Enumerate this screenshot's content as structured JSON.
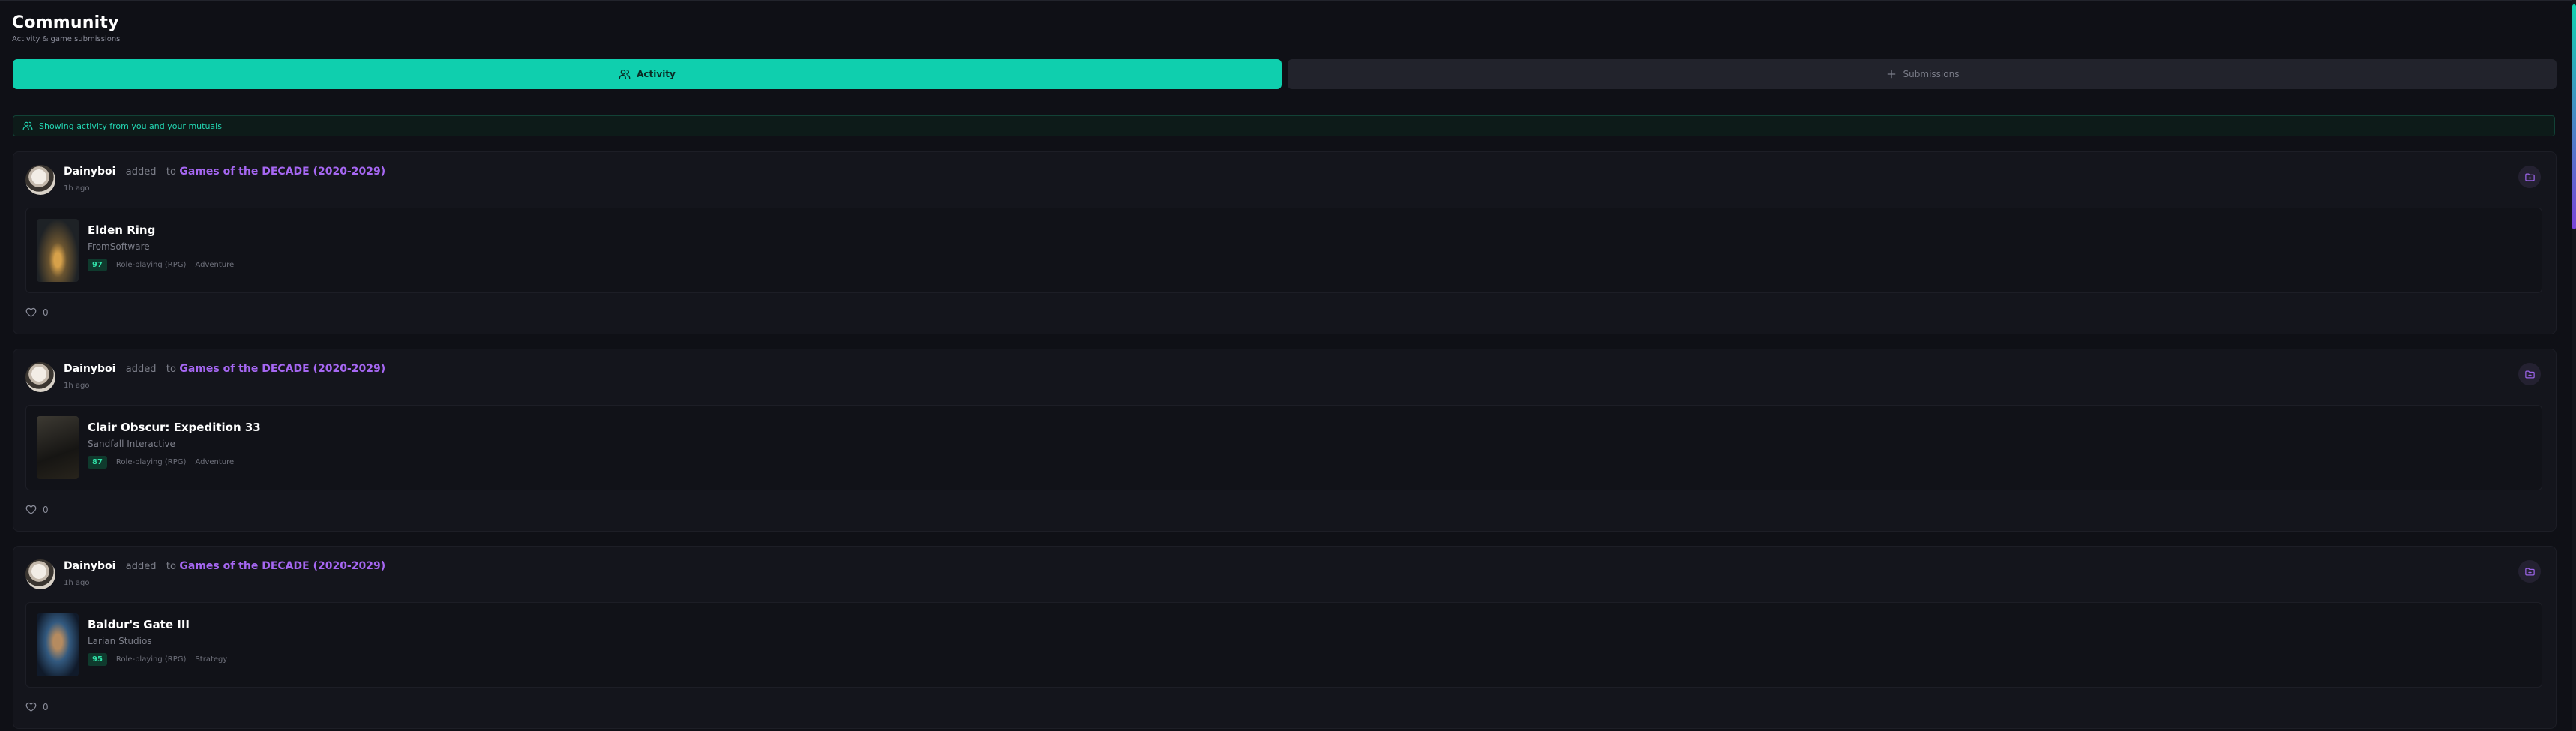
{
  "page": {
    "title": "Community",
    "subtitle": "Activity & game submissions"
  },
  "tabs": [
    {
      "label": "Activity",
      "active": true,
      "icon": "users-icon"
    },
    {
      "label": "Submissions",
      "active": false,
      "icon": "plus-icon"
    }
  ],
  "notice": {
    "text": "Showing activity from you and your mutuals",
    "icon": "users-icon"
  },
  "colors": {
    "accent": "#0fcfae",
    "list_link": "#a667f2",
    "score_bg": "#0f3a2d"
  },
  "feed": [
    {
      "user": "Dainyboi",
      "action": "added",
      "preposition": "to",
      "list": "Games of the DECADE (2020-2029)",
      "time": "1h ago",
      "game": {
        "title": "Elden Ring",
        "developer": "FromSoftware",
        "score": "97",
        "genres": [
          "Role-playing (RPG)",
          "Adventure"
        ]
      },
      "likes": "0"
    },
    {
      "user": "Dainyboi",
      "action": "added",
      "preposition": "to",
      "list": "Games of the DECADE (2020-2029)",
      "time": "1h ago",
      "game": {
        "title": "Clair Obscur: Expedition 33",
        "developer": "Sandfall Interactive",
        "score": "87",
        "genres": [
          "Role-playing (RPG)",
          "Adventure"
        ]
      },
      "likes": "0"
    },
    {
      "user": "Dainyboi",
      "action": "added",
      "preposition": "to",
      "list": "Games of the DECADE (2020-2029)",
      "time": "1h ago",
      "game": {
        "title": "Baldur's Gate III",
        "developer": "Larian Studios",
        "score": "95",
        "genres": [
          "Role-playing (RPG)",
          "Strategy"
        ]
      },
      "likes": "0"
    }
  ]
}
